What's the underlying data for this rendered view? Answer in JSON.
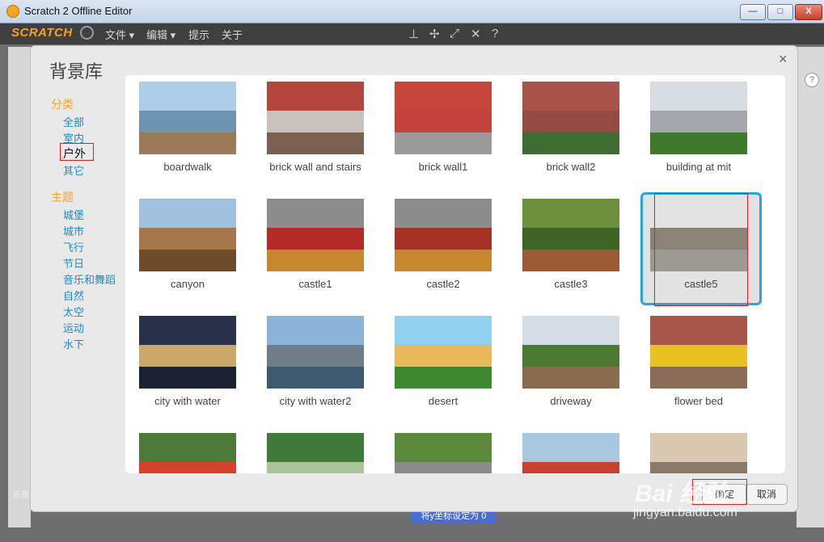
{
  "window": {
    "title": "Scratch 2 Offline Editor",
    "minimize": "—",
    "maximize": "□",
    "close": "X"
  },
  "menubar": {
    "logo": "SCRATCH",
    "file": "文件 ▾",
    "edit": "编辑 ▾",
    "tips": "提示",
    "about": "关于"
  },
  "toolbar_icons": [
    "stamp-icon",
    "cut-icon",
    "grow-icon",
    "shrink-icon",
    "help-icon"
  ],
  "dialog": {
    "title": "背景库",
    "close": "×",
    "category_heading": "分类",
    "categories": [
      "全部",
      "室内",
      "户外",
      "其它"
    ],
    "selected_category": "户外",
    "theme_heading": "主题",
    "themes": [
      "城堡",
      "城市",
      "飞行",
      "节日",
      "音乐和舞蹈",
      "自然",
      "太空",
      "运动",
      "水下"
    ],
    "ok": "确定",
    "cancel": "取消",
    "selected_item": "castle5",
    "items": [
      {
        "label": "boardwalk",
        "colors": [
          "#aecde8",
          "#6f94b1",
          "#9b7a59"
        ]
      },
      {
        "label": "brick wall and stairs",
        "colors": [
          "#b2463c",
          "#c7c2bd",
          "#7a6050"
        ]
      },
      {
        "label": "brick wall1",
        "colors": [
          "#c6463c",
          "#c3423b",
          "#9a9a9a"
        ]
      },
      {
        "label": "brick wall2",
        "colors": [
          "#a8534a",
          "#944c42",
          "#3e6d33"
        ]
      },
      {
        "label": "building at mit",
        "colors": [
          "#d8dde3",
          "#a4a8ad",
          "#3f7a2c"
        ]
      },
      {
        "label": "canyon",
        "colors": [
          "#9fc1e0",
          "#a5774b",
          "#6e4b2a"
        ]
      },
      {
        "label": "castle1",
        "colors": [
          "#8c8c8c",
          "#b42a26",
          "#c6882f"
        ]
      },
      {
        "label": "castle2",
        "colors": [
          "#8c8c8c",
          "#a53325",
          "#c6882f"
        ]
      },
      {
        "label": "castle3",
        "colors": [
          "#6b8f3b",
          "#3d6424",
          "#9b5a33"
        ]
      },
      {
        "label": "castle5",
        "colors": [
          "#e3e3e3",
          "#8b8378",
          "#9c9a95"
        ]
      },
      {
        "label": "city with water",
        "colors": [
          "#28304a",
          "#c9a86a",
          "#1d2233"
        ]
      },
      {
        "label": "city with water2",
        "colors": [
          "#8cb4d8",
          "#6f7d88",
          "#3d5a72"
        ]
      },
      {
        "label": "desert",
        "colors": [
          "#8ed0ee",
          "#e8b85a",
          "#3b8a2f"
        ]
      },
      {
        "label": "driveway",
        "colors": [
          "#d4dde3",
          "#4a7a30",
          "#8b6b4e"
        ]
      },
      {
        "label": "flower bed",
        "colors": [
          "#a8564a",
          "#e8c020",
          "#8a6b55"
        ]
      },
      {
        "label": "",
        "colors": [
          "#4d7a3a",
          "#d8402e",
          "#e27a3a"
        ]
      },
      {
        "label": "",
        "colors": [
          "#3f7a3a",
          "#a9c39a",
          "#2f5a2a"
        ]
      },
      {
        "label": "",
        "colors": [
          "#5a8a3a",
          "#8b8b8b",
          "#3d6a2a"
        ]
      },
      {
        "label": "",
        "colors": [
          "#a8c8e0",
          "#c84030",
          "#5a8a3a"
        ]
      },
      {
        "label": "",
        "colors": [
          "#d8c8b0",
          "#8a7a6a",
          "#c8402a"
        ]
      }
    ]
  },
  "background": {
    "new_sprite": "新建",
    "block_set_y": "将y坐标设定为 0",
    "help": "?"
  },
  "watermark": {
    "line1": "Bai 经验",
    "line2": "jingyan.baidu.com"
  }
}
